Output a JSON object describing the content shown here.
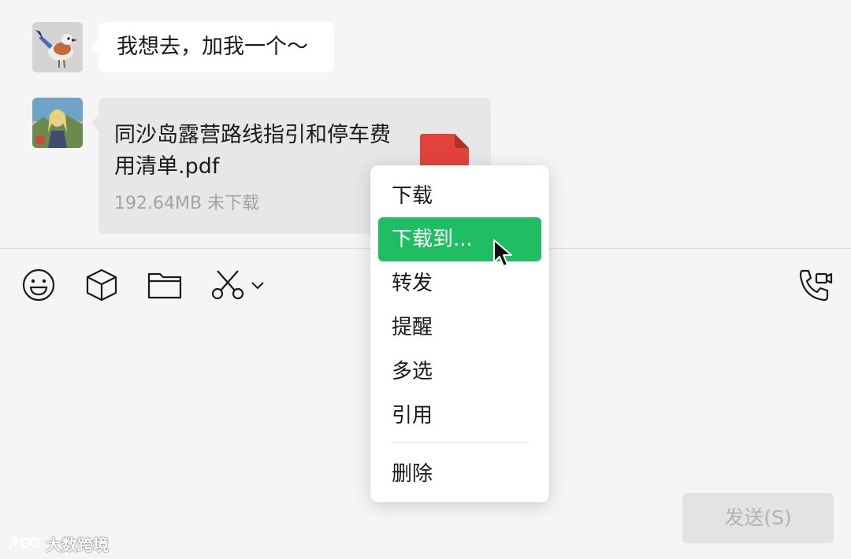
{
  "chat": {
    "messages": [
      {
        "type": "text",
        "text": "我想去，加我一个～"
      },
      {
        "type": "file",
        "file_name": "同沙岛露营路线指引和停车费用清单.pdf",
        "file_size": "192.64MB",
        "file_status": "未下载",
        "file_icon": "pdf-file-icon"
      }
    ]
  },
  "toolbar": {
    "icons": [
      "emoji-icon",
      "sticker-cube-icon",
      "folder-icon",
      "scissors-icon",
      "chevron-down-icon",
      "voice-video-call-icon"
    ]
  },
  "context_menu": {
    "items": [
      {
        "label": "下载",
        "active": false
      },
      {
        "label": "下载到...",
        "active": true
      },
      {
        "label": "转发",
        "active": false
      },
      {
        "label": "提醒",
        "active": false
      },
      {
        "label": "多选",
        "active": false
      },
      {
        "label": "引用",
        "active": false
      },
      {
        "label": "删除",
        "active": false
      }
    ]
  },
  "send_button": {
    "label": "发送(S)"
  },
  "watermark": {
    "text": "大数跨境"
  },
  "colors": {
    "accent": "#1fbe63",
    "background": "#f5f5f5",
    "file_bubble": "#e7e7e7",
    "pdf_red": "#e2443d"
  }
}
